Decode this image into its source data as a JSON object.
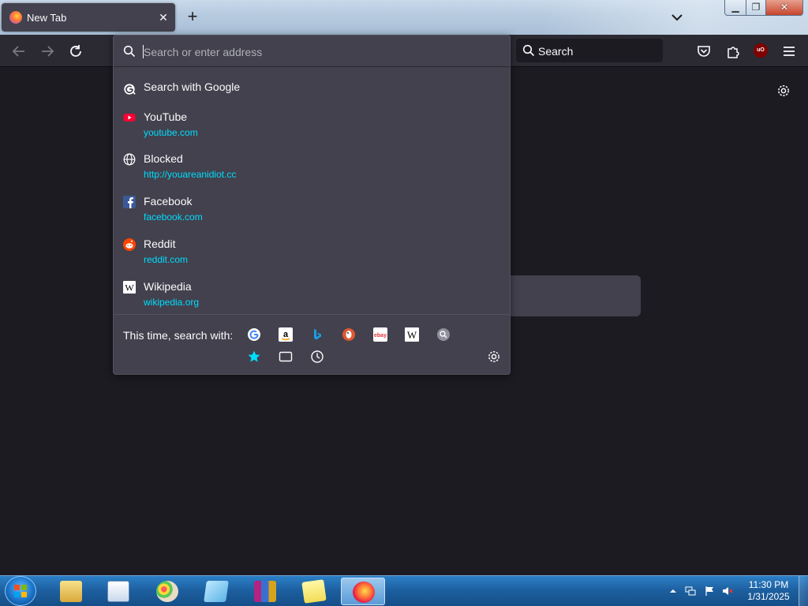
{
  "tab": {
    "title": "New Tab"
  },
  "navbar": {
    "search_label": "Search",
    "ublock_badge": "uO"
  },
  "urlbar": {
    "placeholder": "Search or enter address",
    "google_suggestion": "Search with Google",
    "results": [
      {
        "title": "YouTube",
        "url": "youtube.com",
        "icon": "youtube-icon"
      },
      {
        "title": "Blocked",
        "url": "http://youareanidiot.cc",
        "icon": "globe-icon"
      },
      {
        "title": "Facebook",
        "url": "facebook.com",
        "icon": "facebook-icon"
      },
      {
        "title": "Reddit",
        "url": "reddit.com",
        "icon": "reddit-icon"
      },
      {
        "title": "Wikipedia",
        "url": "wikipedia.org",
        "icon": "wikipedia-icon"
      }
    ],
    "oneoff_label": "This time, search with:",
    "engines": [
      "google-icon",
      "amazon-icon",
      "bing-icon",
      "duckduckgo-icon",
      "ebay-icon",
      "wikipedia-icon",
      "search-engine-icon"
    ],
    "modes": [
      "bookmarks-star-icon",
      "tabs-icon",
      "history-icon"
    ]
  },
  "taskbar": {
    "time": "11:30 PM",
    "date": "1/31/2025",
    "apps": [
      "file-explorer-icon",
      "wordpad-icon",
      "paint-icon",
      "notepad-icon",
      "winrar-icon",
      "sticky-notes-icon",
      "firefox-icon"
    ]
  },
  "colors": {
    "accent_url": "#00ddff",
    "panel": "#42414d",
    "background": "#1c1b22"
  }
}
